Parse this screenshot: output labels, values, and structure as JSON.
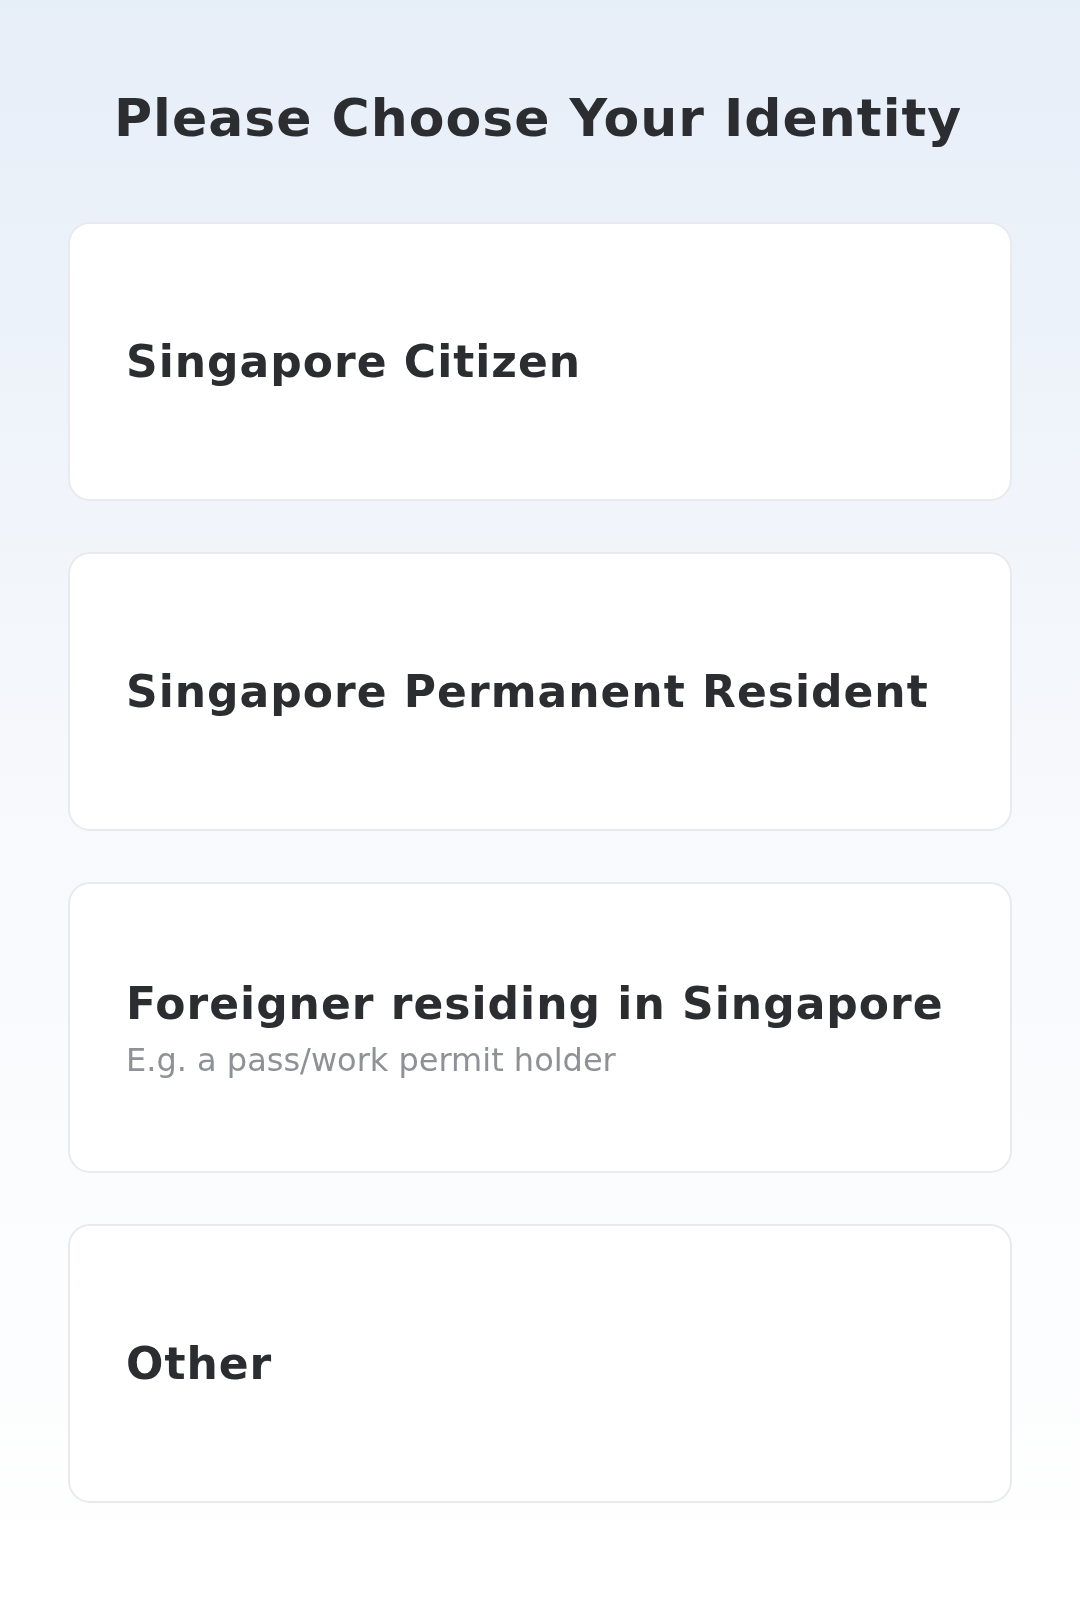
{
  "title": "Please Choose Your Identity",
  "options": [
    {
      "label": "Singapore Citizen"
    },
    {
      "label": "Singapore Permanent Resident"
    },
    {
      "label": "Foreigner residing in Singapore",
      "hint": "E.g. a pass/work permit holder"
    },
    {
      "label": "Other"
    }
  ]
}
